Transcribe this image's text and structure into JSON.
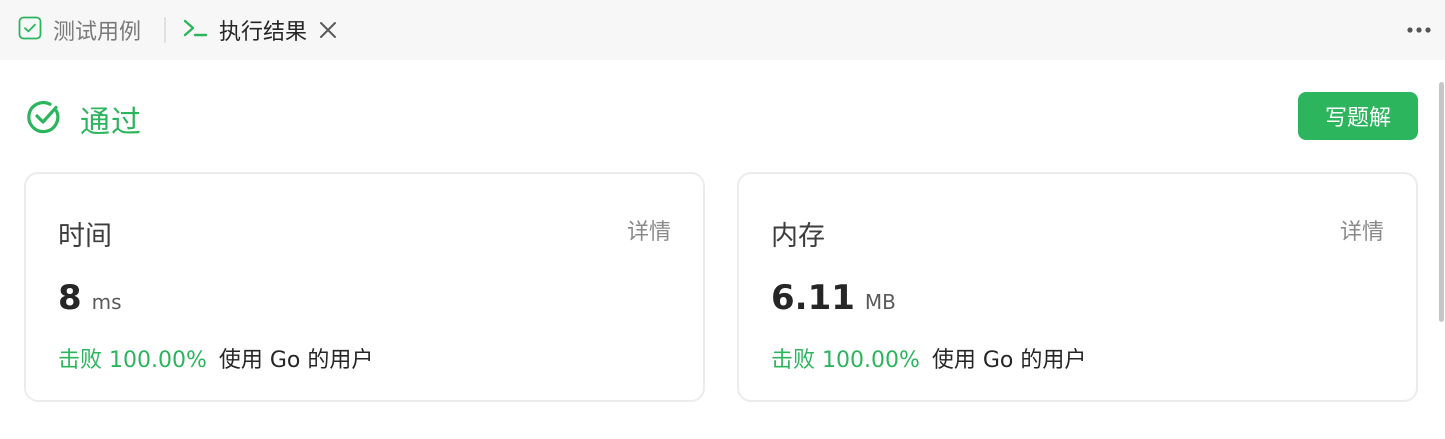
{
  "tabs": {
    "testcases_label": "测试用例",
    "result_label": "执行结果"
  },
  "result": {
    "status": "通过",
    "write_solution_label": "写题解"
  },
  "time_card": {
    "title": "时间",
    "detail_label": "详情",
    "value": "8",
    "unit": "ms",
    "beats": "击败 100.00%",
    "suffix": "使用 Go 的用户"
  },
  "memory_card": {
    "title": "内存",
    "detail_label": "详情",
    "value": "6.11",
    "unit": "MB",
    "beats": "击败 100.00%",
    "suffix": "使用 Go 的用户"
  },
  "colors": {
    "accent": "#2db55d",
    "tabbar_bg": "#f7f7f8",
    "card_border": "#ececec"
  },
  "icons": [
    "checkbox-icon",
    "terminal-icon",
    "close-icon",
    "more-icon",
    "check-circle-icon"
  ]
}
